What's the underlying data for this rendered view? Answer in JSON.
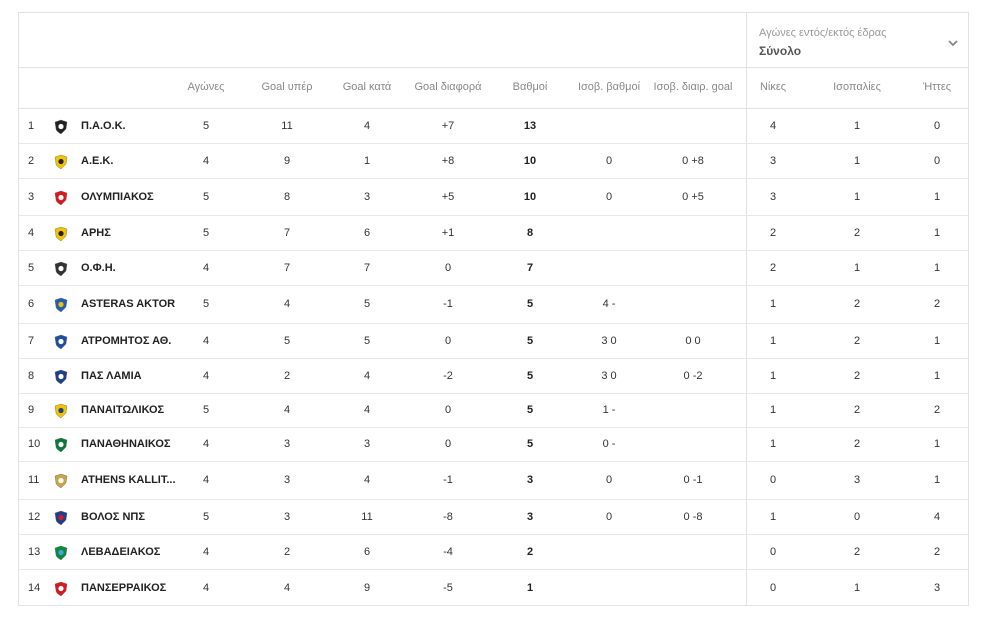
{
  "filter": {
    "caption": "Αγώνες εντός/εκτός έδρας",
    "value": "Σύνολο"
  },
  "columns": {
    "played": "Αγώνες",
    "gf": "Goal υπέρ",
    "ga": "Goal κατά",
    "gd": "Goal διαφορά",
    "pts": "Βαθμοί",
    "eq_pts": "Ισοβ. βαθμοί",
    "eq_gd": "Ισοβ. διαιρ. goal",
    "w": "Νίκες",
    "d": "Ισοπαλίες",
    "l": "Ήττες"
  },
  "rows": [
    {
      "pos": "1",
      "team": "Π.Α.Ο.Κ.",
      "played": "5",
      "gf": "11",
      "ga": "4",
      "gd": "+7",
      "pts": "13",
      "eq_pts": "",
      "eq_gd": "",
      "w": "4",
      "d": "1",
      "l": "0",
      "logo": "paok-logo",
      "c1": "#222222",
      "c2": "#ffffff"
    },
    {
      "pos": "2",
      "team": "Α.Ε.Κ.",
      "played": "4",
      "gf": "9",
      "ga": "1",
      "gd": "+8",
      "pts": "10",
      "eq_pts": "0",
      "eq_gd": "0 +8",
      "w": "3",
      "d": "1",
      "l": "0",
      "logo": "aek-logo",
      "c1": "#f4c400",
      "c2": "#222222"
    },
    {
      "pos": "3",
      "team": "ΟΛΥΜΠΙΑΚΟΣ",
      "played": "5",
      "gf": "8",
      "ga": "3",
      "gd": "+5",
      "pts": "10",
      "eq_pts": "0",
      "eq_gd": "0 +5",
      "w": "3",
      "d": "1",
      "l": "1",
      "logo": "olympiacos-logo",
      "c1": "#d71920",
      "c2": "#ffffff"
    },
    {
      "pos": "4",
      "team": "ΑΡΗΣ",
      "played": "5",
      "gf": "7",
      "ga": "6",
      "gd": "+1",
      "pts": "8",
      "eq_pts": "",
      "eq_gd": "",
      "w": "2",
      "d": "2",
      "l": "1",
      "logo": "aris-logo",
      "c1": "#f2c400",
      "c2": "#222222"
    },
    {
      "pos": "5",
      "team": "Ο.Φ.Η.",
      "played": "4",
      "gf": "7",
      "ga": "7",
      "gd": "0",
      "pts": "7",
      "eq_pts": "",
      "eq_gd": "",
      "w": "2",
      "d": "1",
      "l": "1",
      "logo": "ofi-logo",
      "c1": "#333333",
      "c2": "#ffffff"
    },
    {
      "pos": "6",
      "team": "ASTERAS AKTOR",
      "played": "5",
      "gf": "4",
      "ga": "5",
      "gd": "-1",
      "pts": "5",
      "eq_pts": "4 -",
      "eq_gd": "",
      "w": "1",
      "d": "2",
      "l": "2",
      "logo": "asteras-logo",
      "c1": "#1f5fb5",
      "c2": "#f2c400"
    },
    {
      "pos": "7",
      "team": "ΑΤΡΟΜΗΤΟΣ ΑΘ.",
      "played": "4",
      "gf": "5",
      "ga": "5",
      "gd": "0",
      "pts": "5",
      "eq_pts": "3 0",
      "eq_gd": "0 0",
      "w": "1",
      "d": "2",
      "l": "1",
      "logo": "atromitos-logo",
      "c1": "#1e4fa0",
      "c2": "#ffffff"
    },
    {
      "pos": "8",
      "team": "ΠΑΣ ΛΑΜΙΑ",
      "played": "4",
      "gf": "2",
      "ga": "4",
      "gd": "-2",
      "pts": "5",
      "eq_pts": "3 0",
      "eq_gd": "0 -2",
      "w": "1",
      "d": "2",
      "l": "1",
      "logo": "lamia-logo",
      "c1": "#1e3f8a",
      "c2": "#ffffff"
    },
    {
      "pos": "9",
      "team": "ΠΑΝΑΙΤΩΛΙΚΟΣ",
      "played": "5",
      "gf": "4",
      "ga": "4",
      "gd": "0",
      "pts": "5",
      "eq_pts": "1 -",
      "eq_gd": "",
      "w": "1",
      "d": "2",
      "l": "2",
      "logo": "panetolikos-logo",
      "c1": "#f2c400",
      "c2": "#1e3f8a"
    },
    {
      "pos": "10",
      "team": "ΠΑΝΑΘΗΝΑΙΚΟΣ",
      "played": "4",
      "gf": "3",
      "ga": "3",
      "gd": "0",
      "pts": "5",
      "eq_pts": "0 -",
      "eq_gd": "",
      "w": "1",
      "d": "2",
      "l": "1",
      "logo": "panathinaikos-logo",
      "c1": "#0a7a3b",
      "c2": "#ffffff"
    },
    {
      "pos": "11",
      "team": "ATHENS KALLIT...",
      "played": "4",
      "gf": "3",
      "ga": "4",
      "gd": "-1",
      "pts": "3",
      "eq_pts": "0",
      "eq_gd": "0 -1",
      "w": "0",
      "d": "3",
      "l": "1",
      "logo": "kallithea-logo",
      "c1": "#c9a44a",
      "c2": "#ffffff"
    },
    {
      "pos": "12",
      "team": "ΒΟΛΟΣ ΝΠΣ",
      "played": "5",
      "gf": "3",
      "ga": "11",
      "gd": "-8",
      "pts": "3",
      "eq_pts": "0",
      "eq_gd": "0 -8",
      "w": "1",
      "d": "0",
      "l": "4",
      "logo": "volos-logo",
      "c1": "#1e3f8a",
      "c2": "#d71920"
    },
    {
      "pos": "13",
      "team": "ΛΕΒΑΔΕΙΑΚΟΣ",
      "played": "4",
      "gf": "2",
      "ga": "6",
      "gd": "-4",
      "pts": "2",
      "eq_pts": "",
      "eq_gd": "",
      "w": "0",
      "d": "2",
      "l": "2",
      "logo": "levadiakos-logo",
      "c1": "#0a8a3b",
      "c2": "#4aa3df"
    },
    {
      "pos": "14",
      "team": "ΠΑΝΣΕΡΡΑΙΚΟΣ",
      "played": "4",
      "gf": "4",
      "ga": "9",
      "gd": "-5",
      "pts": "1",
      "eq_pts": "",
      "eq_gd": "",
      "w": "0",
      "d": "1",
      "l": "3",
      "logo": "panserraikos-logo",
      "c1": "#d71920",
      "c2": "#ffffff"
    }
  ]
}
